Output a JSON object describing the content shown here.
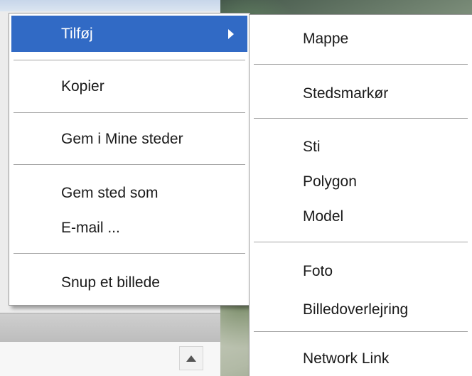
{
  "context_menu": {
    "items": [
      {
        "label": "Tilføj",
        "has_submenu": true,
        "highlighted": true
      },
      {
        "label": "Kopier"
      },
      {
        "label": "Gem i Mine steder"
      },
      {
        "label": "Gem sted som"
      },
      {
        "label": "E-mail ..."
      },
      {
        "label": "Snup et billede"
      }
    ]
  },
  "submenu": {
    "items": [
      {
        "label": "Mappe"
      },
      {
        "label": "Stedsmarkør"
      },
      {
        "label": "Sti"
      },
      {
        "label": "Polygon"
      },
      {
        "label": "Model"
      },
      {
        "label": "Foto"
      },
      {
        "label": "Billedoverlejring"
      },
      {
        "label": "Network Link"
      }
    ]
  },
  "colors": {
    "highlight": "#316ac5",
    "menu_background": "#ffffff"
  },
  "icons": {
    "submenu_arrow": "arrow-right-icon",
    "scroll_up": "arrow-up-icon"
  }
}
